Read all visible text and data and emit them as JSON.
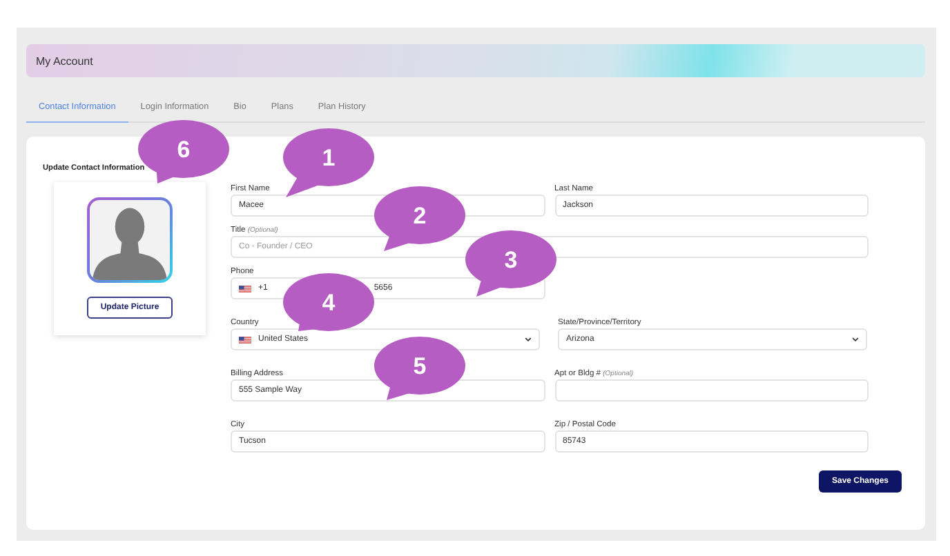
{
  "header": {
    "title": "My Account"
  },
  "tabs": [
    {
      "label": "Contact Information",
      "selected": true
    },
    {
      "label": "Login Information",
      "selected": false
    },
    {
      "label": "Bio",
      "selected": false
    },
    {
      "label": "Plans",
      "selected": false
    },
    {
      "label": "Plan History",
      "selected": false
    }
  ],
  "section_title": "Update Contact Information",
  "profile": {
    "button": "Update Picture"
  },
  "rows": [
    [
      {
        "kind": "text",
        "label": "First Name",
        "value": "Macee"
      },
      {
        "kind": "text",
        "label": "Last Name",
        "value": "Jackson"
      }
    ],
    [
      {
        "kind": "wide",
        "label": "Title",
        "note": "(Optional)",
        "placeholder": "Co - Founder / CEO"
      }
    ],
    [
      {
        "kind": "phone",
        "label": "Phone",
        "code": "+1",
        "value": "5656"
      }
    ],
    [
      {
        "kind": "select",
        "label": "Country",
        "value": "United States",
        "flag": true
      },
      {
        "kind": "select",
        "label": "State/Province/Territory",
        "value": "Arizona",
        "flag": false
      }
    ],
    [
      {
        "kind": "text",
        "label": "Billing Address",
        "value": "555 Sample Way"
      },
      {
        "kind": "text",
        "label": "Apt or Bldg #",
        "note": "(Optional)"
      }
    ],
    [
      {
        "kind": "text",
        "label": "City",
        "value": "Tucson"
      },
      {
        "kind": "text",
        "label": "Zip / Postal Code",
        "value": "85743"
      }
    ]
  ],
  "save_button": "Save Changes",
  "callouts": [
    "1",
    "2",
    "3",
    "4",
    "5",
    "6"
  ]
}
